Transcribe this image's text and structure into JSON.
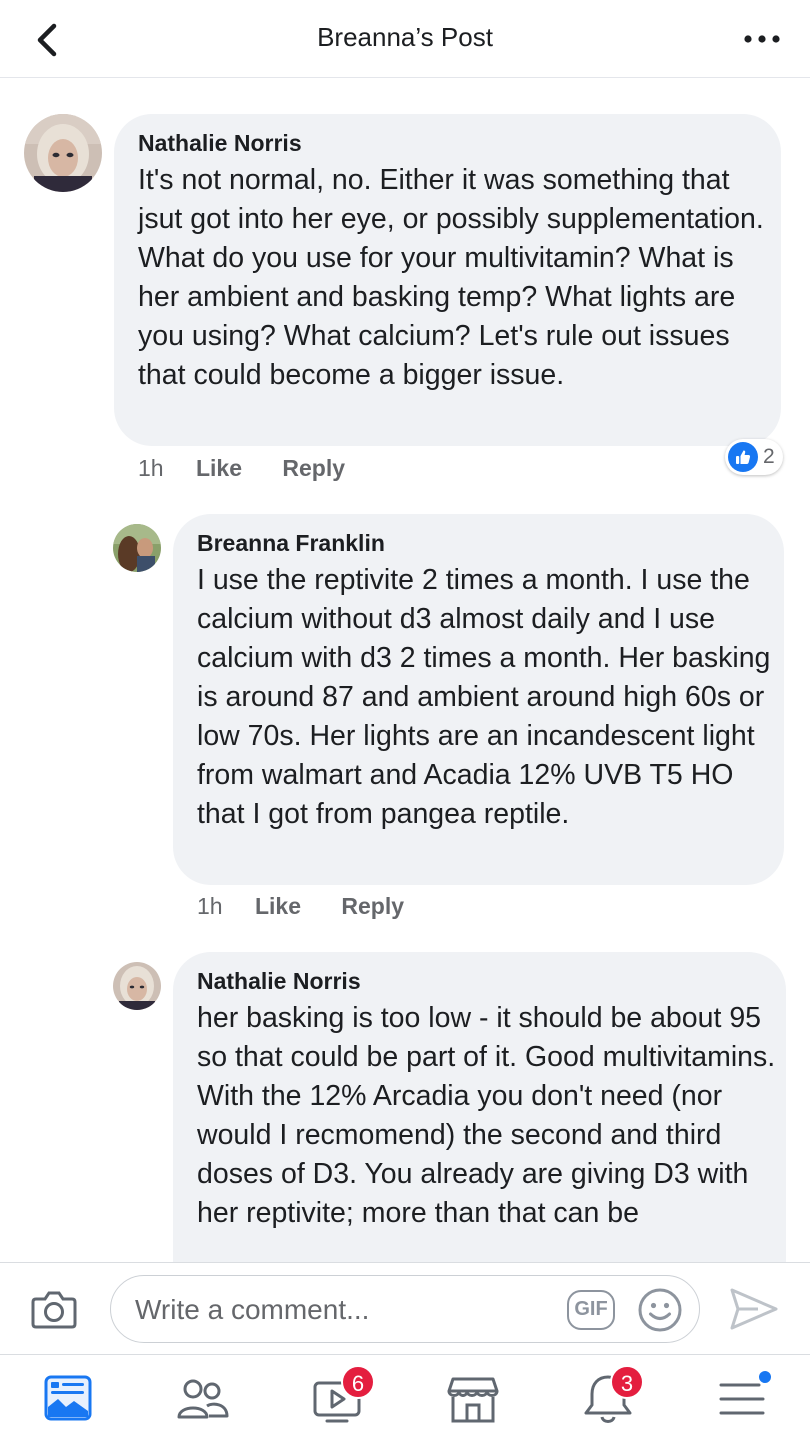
{
  "header": {
    "title": "Breanna’s Post",
    "back_icon": "chevron-left-icon",
    "more_icon": "more-horizontal-icon"
  },
  "comments": [
    {
      "author": "Nathalie Norris",
      "text": "It's not normal, no.  Either it was something that jsut got into her eye, or possibly supplementation.  What do you use for your multivitamin?  What is her ambient and basking temp?  What lights are you using? What calcium?  Let's rule out issues that could become a bigger issue.",
      "time": "1h",
      "like_label": "Like",
      "reply_label": "Reply",
      "reaction_count": "2"
    },
    {
      "author": "Breanna Franklin",
      "text": "I use the reptivite 2 times a month. I use the calcium without d3 almost daily and I use calcium with d3 2 times a month. Her basking is around 87 and ambient around high 60s or low 70s. Her lights are an incandescent light from walmart and Acadia 12% UVB T5 HO that I got from pangea reptile.",
      "time": "1h",
      "like_label": "Like",
      "reply_label": "Reply"
    },
    {
      "author": "Nathalie Norris",
      "text": "her basking is too low - it should be about 95 so that could be part of it.  Good multivitamins.  With the 12% Arcadia you don't need (nor would I recmomend) the second and third doses of D3.  You already are giving D3 with her reptivite; more than that can be"
    }
  ],
  "composer": {
    "placeholder": "Write a comment...",
    "gif_label": "GIF"
  },
  "tabbar": {
    "watch_badge": "6",
    "notifications_badge": "3"
  },
  "colors": {
    "accent": "#1877f2",
    "badge": "#e41e3f",
    "bubble": "#f0f2f5"
  }
}
